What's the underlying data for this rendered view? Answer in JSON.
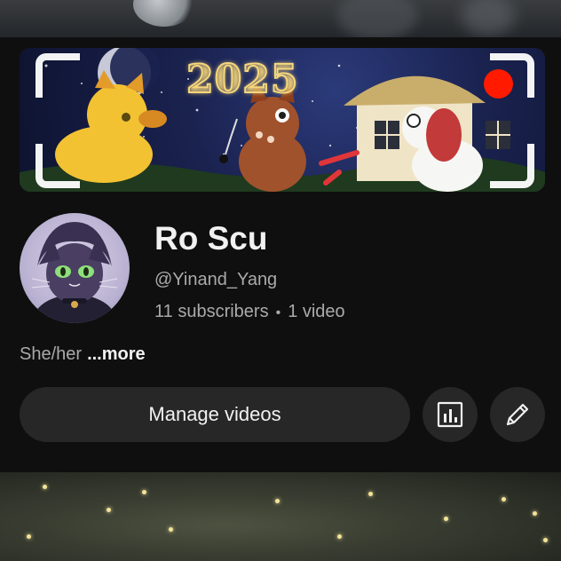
{
  "banner": {
    "image_name": "channel-banner",
    "year_text": "2025",
    "record_dot_color": "#ff1a00"
  },
  "channel": {
    "name": "Ro Scu",
    "handle": "@Yinand_Yang",
    "subscribers": "11 subscribers",
    "separator": "•",
    "videos": "1 video",
    "avatar_name": "channel-avatar"
  },
  "description": {
    "text": "She/her",
    "more_label": "...more"
  },
  "actions": {
    "manage_label": "Manage videos",
    "stats_icon": "bar-chart-icon",
    "edit_icon": "pencil-icon"
  },
  "colors": {
    "background": "#0f0f0f",
    "button_bg": "#272727",
    "primary_text": "#f1f1f1",
    "secondary_text": "#aaaaaa"
  }
}
